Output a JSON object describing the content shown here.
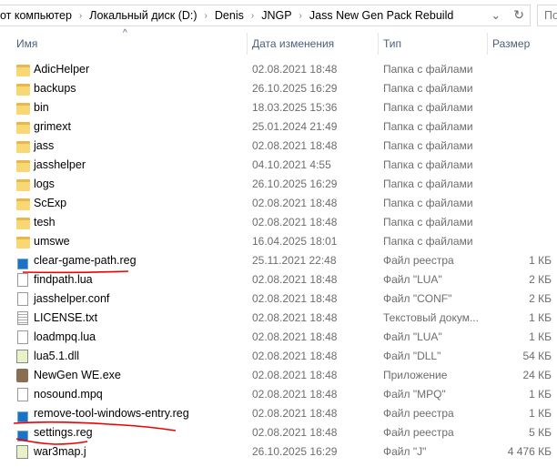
{
  "address": {
    "crumbs": [
      "от компьютер",
      "Локальный диск (D:)",
      "Denis",
      "JNGP",
      "Jass New Gen Pack Rebuild"
    ],
    "search_placeholder": "По"
  },
  "columns": {
    "name": "Имя",
    "date": "Дата изменения",
    "type": "Тип",
    "size": "Размер"
  },
  "files": [
    {
      "name": "AdicHelper",
      "date": "02.08.2021 18:48",
      "type": "Папка с файлами",
      "size": "",
      "icon": "folder"
    },
    {
      "name": "backups",
      "date": "26.10.2025 16:29",
      "type": "Папка с файлами",
      "size": "",
      "icon": "folder"
    },
    {
      "name": "bin",
      "date": "18.03.2025 15:36",
      "type": "Папка с файлами",
      "size": "",
      "icon": "folder"
    },
    {
      "name": "grimext",
      "date": "25.01.2024 21:49",
      "type": "Папка с файлами",
      "size": "",
      "icon": "folder"
    },
    {
      "name": "jass",
      "date": "02.08.2021 18:48",
      "type": "Папка с файлами",
      "size": "",
      "icon": "folder"
    },
    {
      "name": "jasshelper",
      "date": "04.10.2021 4:55",
      "type": "Папка с файлами",
      "size": "",
      "icon": "folder"
    },
    {
      "name": "logs",
      "date": "26.10.2025 16:29",
      "type": "Папка с файлами",
      "size": "",
      "icon": "folder"
    },
    {
      "name": "ScExp",
      "date": "02.08.2021 18:48",
      "type": "Папка с файлами",
      "size": "",
      "icon": "folder"
    },
    {
      "name": "tesh",
      "date": "02.08.2021 18:48",
      "type": "Папка с файлами",
      "size": "",
      "icon": "folder"
    },
    {
      "name": "umswe",
      "date": "16.04.2025 18:01",
      "type": "Папка с файлами",
      "size": "",
      "icon": "folder"
    },
    {
      "name": "clear-game-path.reg",
      "date": "25.11.2021 22:48",
      "type": "Файл реестра",
      "size": "1 КБ",
      "icon": "reg"
    },
    {
      "name": "findpath.lua",
      "date": "02.08.2021 18:48",
      "type": "Файл \"LUA\"",
      "size": "2 КБ",
      "icon": "file"
    },
    {
      "name": "jasshelper.conf",
      "date": "02.08.2021 18:48",
      "type": "Файл \"CONF\"",
      "size": "2 КБ",
      "icon": "file"
    },
    {
      "name": "LICENSE.txt",
      "date": "02.08.2021 18:48",
      "type": "Текстовый докум...",
      "size": "1 КБ",
      "icon": "txt"
    },
    {
      "name": "loadmpq.lua",
      "date": "02.08.2021 18:48",
      "type": "Файл \"LUA\"",
      "size": "1 КБ",
      "icon": "file"
    },
    {
      "name": "lua5.1.dll",
      "date": "02.08.2021 18:48",
      "type": "Файл \"DLL\"",
      "size": "54 КБ",
      "icon": "dll"
    },
    {
      "name": "NewGen WE.exe",
      "date": "02.08.2021 18:48",
      "type": "Приложение",
      "size": "24 КБ",
      "icon": "exe"
    },
    {
      "name": "nosound.mpq",
      "date": "02.08.2021 18:48",
      "type": "Файл \"MPQ\"",
      "size": "1 КБ",
      "icon": "file"
    },
    {
      "name": "remove-tool-windows-entry.reg",
      "date": "02.08.2021 18:48",
      "type": "Файл реестра",
      "size": "1 КБ",
      "icon": "reg"
    },
    {
      "name": "settings.reg",
      "date": "02.08.2021 18:48",
      "type": "Файл реестра",
      "size": "5 КБ",
      "icon": "reg"
    },
    {
      "name": "war3map.j",
      "date": "26.10.2025 16:29",
      "type": "Файл \"J\"",
      "size": "4 476 КБ",
      "icon": "dll"
    }
  ]
}
